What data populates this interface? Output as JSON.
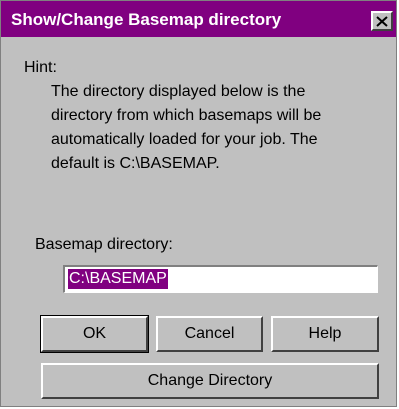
{
  "window": {
    "title": "Show/Change Basemap directory",
    "close_icon": "close-icon"
  },
  "hint": {
    "heading": "Hint:",
    "lines": [
      "The directory displayed below is the",
      "directory from which basemaps will be",
      "automatically loaded for your job.  The",
      "default is C:\\BASEMAP."
    ]
  },
  "basemap": {
    "label": "Basemap directory:",
    "value": "C:\\BASEMAP"
  },
  "buttons": {
    "ok": "OK",
    "cancel": "Cancel",
    "help": "Help",
    "change_directory": "Change Directory"
  },
  "colors": {
    "titlebar": "#800080",
    "dialog_face": "#c0c0c0",
    "selection": "#800080"
  }
}
